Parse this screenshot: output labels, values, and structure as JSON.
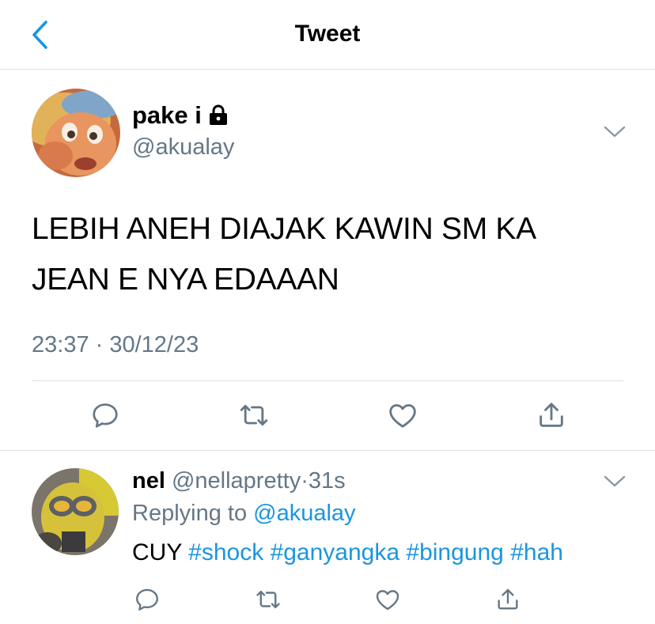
{
  "header": {
    "title": "Tweet",
    "back_icon": "chevron-left-icon"
  },
  "tweet": {
    "author_name": "pake i",
    "locked_icon": "lock-icon",
    "handle": "@akualay",
    "text_line1": "LEBIH ANEH DIAJAK KAWIN SM KA",
    "text_line2": "JEAN E NYA EDAAAN",
    "timestamp": "23:37 · 30/12/23",
    "actions": [
      "comment-icon",
      "retweet-icon",
      "like-icon",
      "share-icon"
    ]
  },
  "reply": {
    "name": "nel",
    "handle": "@nellapretty",
    "time_sep": "·",
    "time": "31s",
    "replying_prefix": "Replying to",
    "replying_to": "@akualay",
    "text_plain": "CUY",
    "hashtags": [
      "#shock",
      "#ganyangka",
      "#bingung",
      "#hah"
    ],
    "actions": [
      "comment-icon",
      "retweet-icon",
      "like-icon",
      "share-icon"
    ]
  },
  "colors": {
    "accent": "#1b95e0",
    "secondary_text": "#657786",
    "icon": "#657786",
    "divider": "#dcdfe2"
  }
}
